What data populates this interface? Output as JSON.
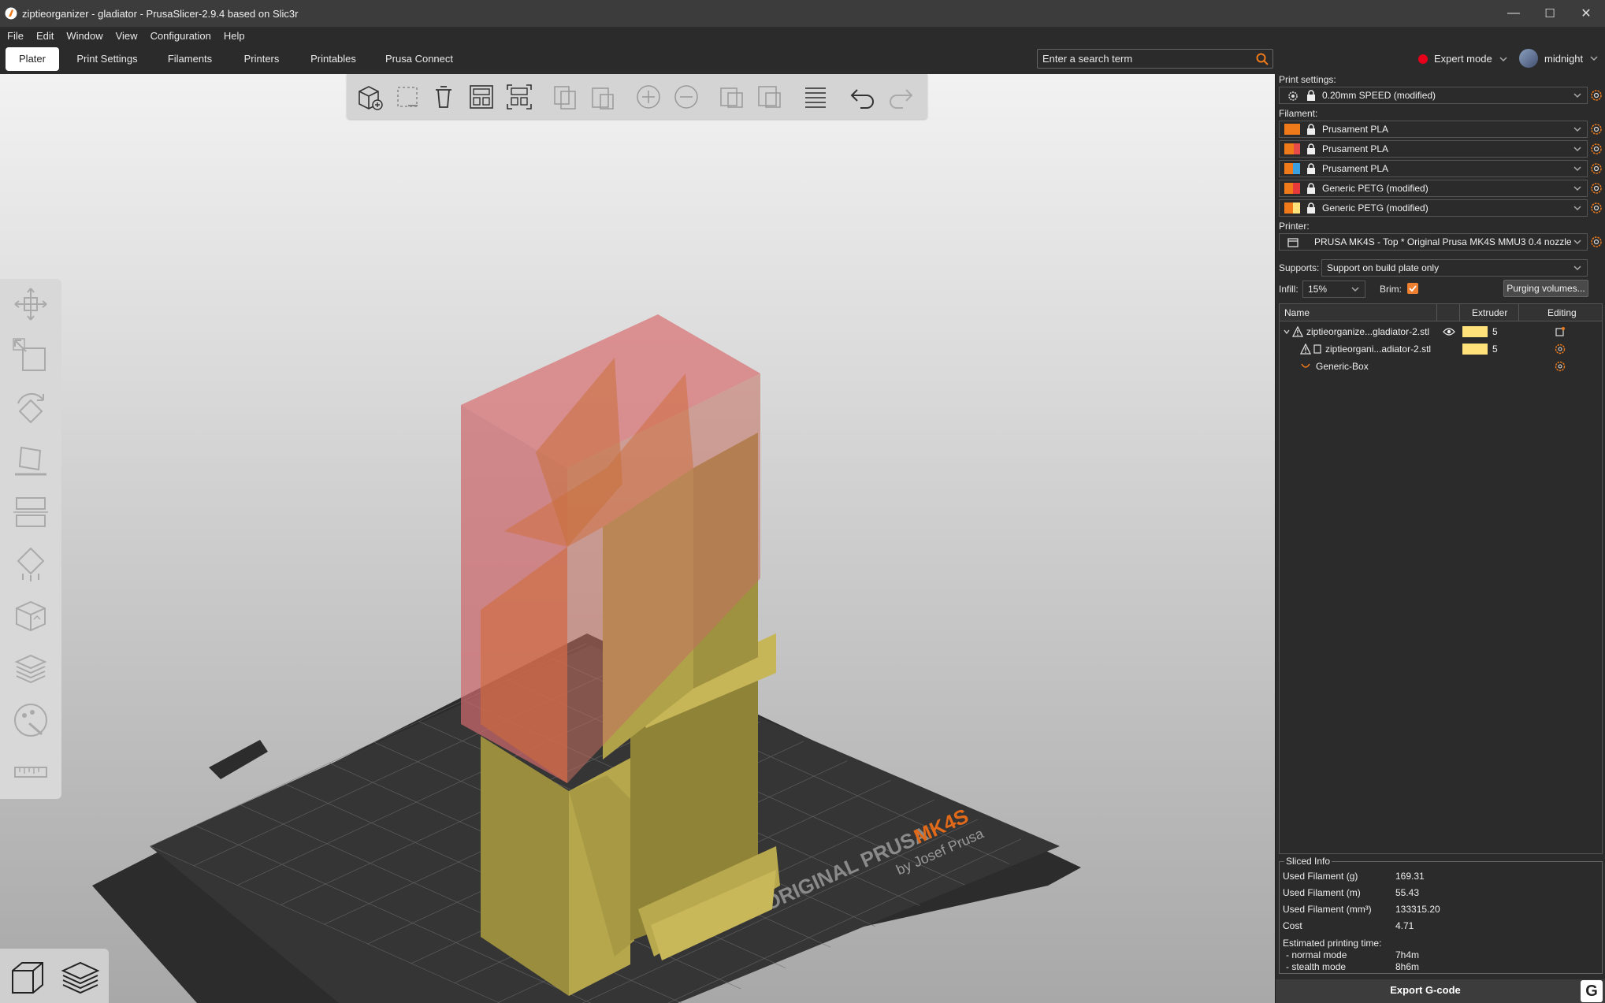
{
  "window": {
    "title": "ziptieorganizer - gladiator - PrusaSlicer-2.9.4 based on Slic3r",
    "controls": {
      "minimize": "—",
      "maximize": "☐",
      "close": "✕"
    }
  },
  "menubar": [
    "File",
    "Edit",
    "Window",
    "View",
    "Configuration",
    "Help"
  ],
  "tabs": [
    "Plater",
    "Print Settings",
    "Filaments",
    "Printers",
    "Printables",
    "Prusa Connect"
  ],
  "search": {
    "placeholder": "Enter a search term"
  },
  "mode": {
    "label": "Expert mode",
    "color": "#e8001a"
  },
  "user": {
    "name": "midnight"
  },
  "bed_text": {
    "brand": "ORIGINAL PRUSA",
    "model": "MK4S",
    "by": "by Josef Prusa"
  },
  "sidebar": {
    "print_settings_label": "Print settings:",
    "print_profile": "0.20mm SPEED (modified)",
    "filament_label": "Filament:",
    "filaments": [
      {
        "name": "Prusament PLA",
        "colors": [
          "#f07a1a",
          "#f07a1a"
        ]
      },
      {
        "name": "Prusament PLA",
        "colors": [
          "#f07a1a",
          "#e84a4a"
        ]
      },
      {
        "name": "Prusament PLA",
        "colors": [
          "#f07a1a",
          "#3aa0e0"
        ]
      },
      {
        "name": "Generic PETG (modified)",
        "colors": [
          "#f07a1a",
          "#e83a3a"
        ]
      },
      {
        "name": "Generic PETG (modified)",
        "colors": [
          "#f07a1a",
          "#ffe37a"
        ]
      }
    ],
    "printer_label": "Printer:",
    "printer": "PRUSA MK4S - Top * Original Prusa MK4S MMU3 0.4 nozzle",
    "supports_label": "Supports:",
    "supports": "Support on build plate only",
    "infill_label": "Infill:",
    "infill": "15%",
    "brim_label": "Brim:",
    "brim_checked": true,
    "purging_button": "Purging volumes...",
    "object_list": {
      "headers": {
        "name": "Name",
        "extruder": "Extruder",
        "editing": "Editing"
      },
      "rows": [
        {
          "name": "ziptieorganize...gladiator-2.stl",
          "extruder": "5",
          "level": 0
        },
        {
          "name": "ziptieorgani...adiator-2.stl",
          "extruder": "5",
          "level": 1
        },
        {
          "name": "Generic-Box",
          "extruder": "",
          "level": 1
        }
      ]
    },
    "sliced_info": {
      "title": "Sliced Info",
      "items": [
        {
          "label": "Used Filament (g)",
          "value": "169.31"
        },
        {
          "label": "Used Filament (m)",
          "value": "55.43"
        },
        {
          "label": "Used Filament (mm³)",
          "value": "133315.20"
        },
        {
          "label": "Cost",
          "value": "4.71"
        }
      ],
      "time_label": "Estimated printing time:",
      "normal_label": "- normal mode",
      "normal_value": "7h4m",
      "stealth_label": "- stealth mode",
      "stealth_value": "8h6m"
    },
    "export_button": "Export G-code",
    "export_icon": "G"
  },
  "colors": {
    "accent": "#f07a1a",
    "object_yellow": "#b8a84e",
    "modifier_red": "#d9787a"
  }
}
